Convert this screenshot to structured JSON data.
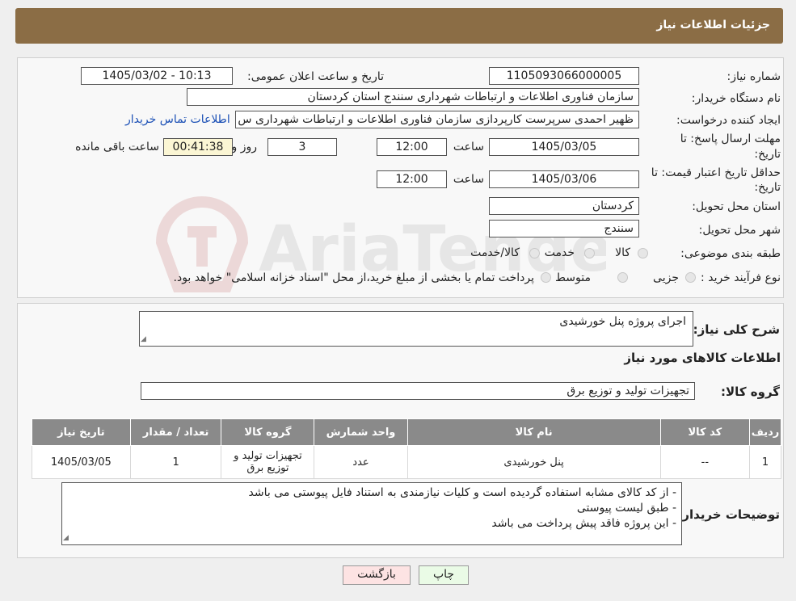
{
  "header": {
    "title": "جزئیات اطلاعات نیاز"
  },
  "form": {
    "need_number_label": "شماره نیاز:",
    "need_number": "1105093066000005",
    "announce_label": "تاریخ و ساعت اعلان عمومی:",
    "announce_value": "1405/03/02 - 10:13",
    "buyer_label": "نام دستگاه خریدار:",
    "buyer_value": "سازمان فناوری اطلاعات و ارتباطات شهرداری سنندج استان کردستان",
    "creator_label": "ایجاد کننده درخواست:",
    "creator_value": "ظهیر احمدی سرپرست کارپردازی سازمان فناوری اطلاعات و ارتباطات شهرداری س",
    "contact_link": "اطلاعات تماس خریدار",
    "deadline_label_1": "مهلت ارسال پاسخ: تا",
    "deadline_label_2": "تاریخ:",
    "deadline_date": "1405/03/05",
    "time_label": "ساعت",
    "deadline_time": "12:00",
    "days_value": "3",
    "days_label": "روز و",
    "remaining_value": "00:41:38",
    "remaining_label": "ساعت باقی مانده",
    "validity_label_1": "حداقل تاریخ اعتبار قیمت: تا",
    "validity_label_2": "تاریخ:",
    "validity_date": "1405/03/06",
    "validity_time": "12:00",
    "province_label": "استان محل تحویل:",
    "province_value": "کردستان",
    "city_label": "شهر محل تحویل:",
    "city_value": "سنندج",
    "category_label": "طبقه بندی موضوعی:",
    "category_options": [
      "کالا",
      "خدمت",
      "کالا/خدمت"
    ],
    "process_label": "نوع فرآیند خرید :",
    "process_options": [
      "جزیی",
      "متوسط"
    ],
    "process_note": "پرداخت تمام یا بخشی از مبلغ خرید،از محل \"اسناد خزانه اسلامی\" خواهد بود."
  },
  "details": {
    "summary_label": "شرح کلی نیاز:",
    "summary_value": "اجرای پروژه پنل خورشیدی",
    "goods_info_title": "اطلاعات کالاهای مورد نیاز",
    "goods_group_label": "گروه کالا:",
    "goods_group_value": "تجهیزات تولید و توزیع برق",
    "table": {
      "headers": [
        "ردیف",
        "کد کالا",
        "نام کالا",
        "واحد شمارش",
        "گروه کالا",
        "تعداد / مقدار",
        "تاریخ نیاز"
      ],
      "rows": [
        [
          "1",
          "--",
          "پنل خورشیدی",
          "عدد",
          "تجهیزات تولید و توزیع برق",
          "1",
          "1405/03/05"
        ]
      ]
    },
    "buyer_notes_label": "توضیحات خریدار:",
    "buyer_notes": [
      "- از کد کالای مشابه استفاده گردیده است و کلیات نیازمندی به استناد فایل پیوستی می باشد",
      "- طبق لیست پیوستی",
      "- این پروژه فاقد پیش پرداخت می باشد"
    ]
  },
  "buttons": {
    "print": "چاپ",
    "back": "بازگشت"
  },
  "watermark": {
    "text": "AriaTender.neT"
  }
}
